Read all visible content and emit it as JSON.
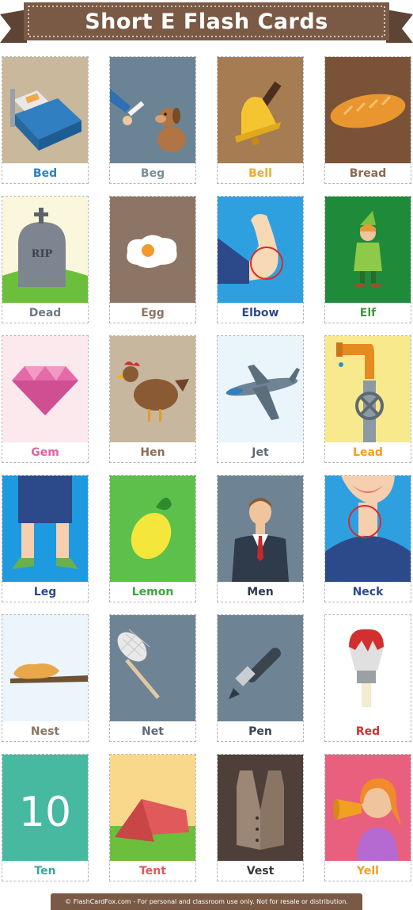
{
  "title": "Short E Flash Cards",
  "footer": "© FlashCardFox.com - For personal and classroom use only. Not for resale or distribution.",
  "colors": {
    "banner": "#7a5a45",
    "banner_dark": "#5e4434",
    "footer": "#7a5a45"
  },
  "cards": [
    {
      "word": "Bed",
      "color": "#2f7fc1",
      "bg": "#c9b89c",
      "icon": "bed-icon"
    },
    {
      "word": "Beg",
      "color": "#7a8f9b",
      "bg": "#6b8495",
      "icon": "dog-icon"
    },
    {
      "word": "Bell",
      "color": "#f0ab2a",
      "bg": "#a67c52",
      "icon": "bell-icon"
    },
    {
      "word": "Bread",
      "color": "#8a6a4e",
      "bg": "#7a5238",
      "icon": "bread-icon"
    },
    {
      "word": "Dead",
      "color": "#6e7a86",
      "bg": "#fbf7dc",
      "icon": "tombstone-icon"
    },
    {
      "word": "Egg",
      "color": "#8d7566",
      "bg": "#8d7566",
      "icon": "egg-icon"
    },
    {
      "word": "Elbow",
      "color": "#2c4a8a",
      "bg": "#2ea0e0",
      "icon": "elbow-icon"
    },
    {
      "word": "Elf",
      "color": "#3e9a3e",
      "bg": "#1f8a3a",
      "icon": "elf-icon"
    },
    {
      "word": "Gem",
      "color": "#e063a4",
      "bg": "#fbe9ee",
      "icon": "gem-icon"
    },
    {
      "word": "Hen",
      "color": "#8a6f57",
      "bg": "#c8b79f",
      "icon": "hen-icon"
    },
    {
      "word": "Jet",
      "color": "#5c6b75",
      "bg": "#eaf4fb",
      "icon": "jet-icon"
    },
    {
      "word": "Lead",
      "color": "#f0a022",
      "bg": "#f7e98c",
      "icon": "pipe-icon"
    },
    {
      "word": "Leg",
      "color": "#2c4a8a",
      "bg": "#1e9ae0",
      "icon": "leg-icon"
    },
    {
      "word": "Lemon",
      "color": "#3ea33e",
      "bg": "#5cc04a",
      "icon": "lemon-icon"
    },
    {
      "word": "Men",
      "color": "#2f3a4a",
      "bg": "#6e8494",
      "icon": "man-icon"
    },
    {
      "word": "Neck",
      "color": "#2c4a8a",
      "bg": "#2ea0e0",
      "icon": "neck-icon"
    },
    {
      "word": "Nest",
      "color": "#8a7563",
      "bg": "#ecf5fb",
      "icon": "nest-icon"
    },
    {
      "word": "Net",
      "color": "#5c6b75",
      "bg": "#6e8494",
      "icon": "net-icon"
    },
    {
      "word": "Pen",
      "color": "#3a4550",
      "bg": "#6e8494",
      "icon": "pen-icon"
    },
    {
      "word": "Red",
      "color": "#d32f2f",
      "bg": "#ffffff",
      "icon": "paintbrush-icon"
    },
    {
      "word": "Ten",
      "color": "#3aa89a",
      "bg": "#47b9a0",
      "icon": "number-ten-icon",
      "glyph": "10"
    },
    {
      "word": "Tent",
      "color": "#d85a5a",
      "bg": "#f8d98c",
      "icon": "tent-icon"
    },
    {
      "word": "Vest",
      "color": "#3a3a3a",
      "bg": "#4e4038",
      "icon": "vest-icon"
    },
    {
      "word": "Yell",
      "color": "#f0a022",
      "bg": "#e8607e",
      "icon": "yelling-girl-icon"
    }
  ]
}
